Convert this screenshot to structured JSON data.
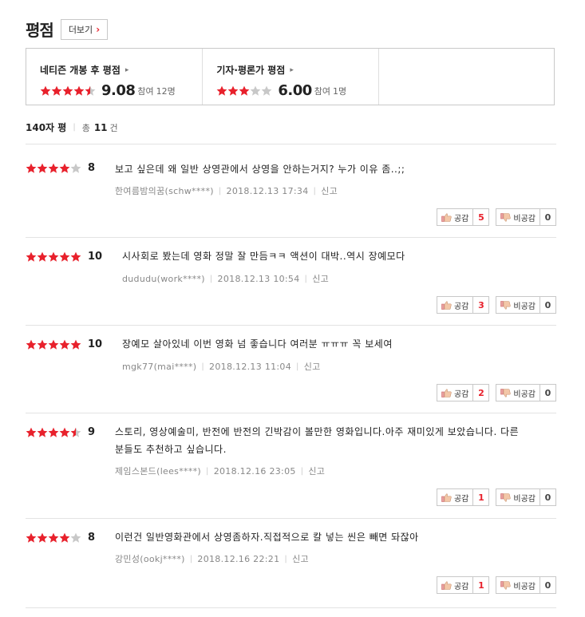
{
  "header": {
    "title": "평점",
    "more_label": "더보기"
  },
  "summary": {
    "audience": {
      "label": "네티즌 개봉 후 평점",
      "rating_stars": 4.5,
      "score": "9.08",
      "part_label": "참여",
      "part_count": "12명"
    },
    "critic": {
      "label": "기자·평론가 평점",
      "rating_stars": 3,
      "score": "6.00",
      "part_label": "참여",
      "part_count": "1명"
    }
  },
  "list_header": {
    "title": "140자 평",
    "total_prefix": "총",
    "total_count": "11",
    "total_suffix": "건"
  },
  "reviews": [
    {
      "stars": 4,
      "score": "8",
      "text": "보고 싶은데 왜 일반 상영관에서 상영을 안하는거지? 누가 이유 좀..;;",
      "author": "한여름밤의꿈(schw****)",
      "date": "2018.12.13 17:34",
      "report": "신고",
      "like_label": "공감",
      "like_count": "5",
      "dislike_label": "비공감",
      "dislike_count": "0"
    },
    {
      "stars": 5,
      "score": "10",
      "text": "시사회로 봤는데 영화 정말 잘 만듬ㅋㅋ 액션이 대박..역시 장예모다",
      "author": "dududu(work****)",
      "date": "2018.12.13 10:54",
      "report": "신고",
      "like_label": "공감",
      "like_count": "3",
      "dislike_label": "비공감",
      "dislike_count": "0"
    },
    {
      "stars": 5,
      "score": "10",
      "text": "장예모 살아있네 이번 영화 넘 좋습니다 여러분 ㅠㅠㅠ 꼭 보세여",
      "author": "mgk77(mai****)",
      "date": "2018.12.13 11:04",
      "report": "신고",
      "like_label": "공감",
      "like_count": "2",
      "dislike_label": "비공감",
      "dislike_count": "0"
    },
    {
      "stars": 4.5,
      "score": "9",
      "text": "스토리, 영상예술미, 반전에 반전의 긴박감이 볼만한 영화입니다.아주 재미있게 보았습니다. 다른 분들도 추천하고 싶습니다.",
      "author": "제임스본드(lees****)",
      "date": "2018.12.16 23:05",
      "report": "신고",
      "like_label": "공감",
      "like_count": "1",
      "dislike_label": "비공감",
      "dislike_count": "0"
    },
    {
      "stars": 4,
      "score": "8",
      "text": "이런건 일반영화관에서 상영좀하자.직접적으로 칼 넣는 씬은 빼면 돠잖아",
      "author": "강민성(ookj****)",
      "date": "2018.12.16 22:21",
      "report": "신고",
      "like_label": "공감",
      "like_count": "1",
      "dislike_label": "비공감",
      "dislike_count": "0"
    }
  ],
  "colors": {
    "star_on": "#e8212c",
    "star_off": "#c8c8c8",
    "accent": "#e8212c"
  }
}
